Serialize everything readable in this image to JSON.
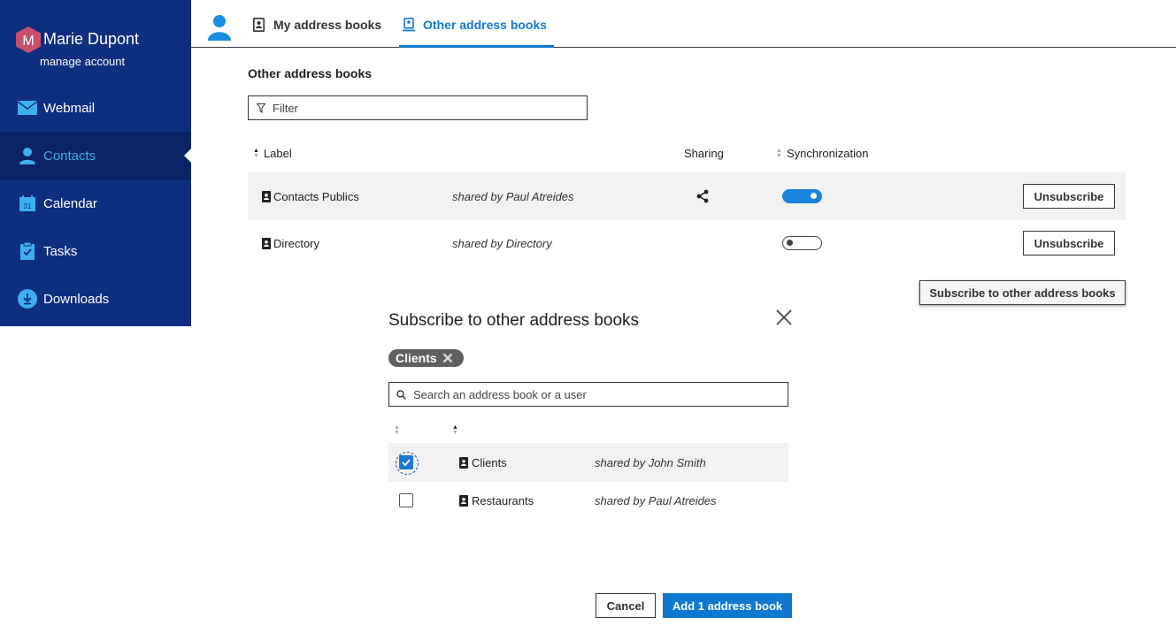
{
  "sidebar": {
    "user_name": "Marie Dupont",
    "avatar_letter": "M",
    "manage_label": "manage account",
    "items": [
      {
        "label": "Webmail",
        "icon": "envelope-icon"
      },
      {
        "label": "Contacts",
        "icon": "person-icon"
      },
      {
        "label": "Calendar",
        "icon": "calendar-icon"
      },
      {
        "label": "Tasks",
        "icon": "clipboard-icon"
      },
      {
        "label": "Downloads",
        "icon": "download-icon"
      }
    ],
    "active": "Contacts",
    "calendar_day": "31"
  },
  "tabs": {
    "items": [
      {
        "label": "My address books",
        "icon": "address-book-icon"
      },
      {
        "label": "Other address books",
        "icon": "shared-address-book-icon"
      }
    ],
    "active": "Other address books"
  },
  "main": {
    "title": "Other address books",
    "filter_placeholder": "Filter",
    "columns": {
      "label": "Label",
      "sharing": "Sharing",
      "sync": "Synchronization"
    },
    "rows": [
      {
        "label": "Contacts Publics",
        "shared_by": "shared by Paul Atreides",
        "shared": true,
        "sync": true,
        "action": "Unsubscribe"
      },
      {
        "label": "Directory",
        "shared_by": "shared by Directory",
        "shared": false,
        "sync": false,
        "action": "Unsubscribe"
      }
    ],
    "subscribe_button": "Subscribe to other address books"
  },
  "dialog": {
    "title": "Subscribe to other address books",
    "chip": "Clients",
    "search_placeholder": "Search an address book or a user",
    "rows": [
      {
        "label": "Clients",
        "shared_by": "shared by John Smith",
        "checked": true
      },
      {
        "label": "Restaurants",
        "shared_by": "shared by Paul Atreides",
        "checked": false
      }
    ],
    "cancel_label": "Cancel",
    "add_label": "Add 1 address book"
  },
  "colors": {
    "sidebar_bg": "#0e2e80",
    "sidebar_active_bg": "#0a2364",
    "accent": "#1478d0",
    "avatar": "#c8506e"
  }
}
